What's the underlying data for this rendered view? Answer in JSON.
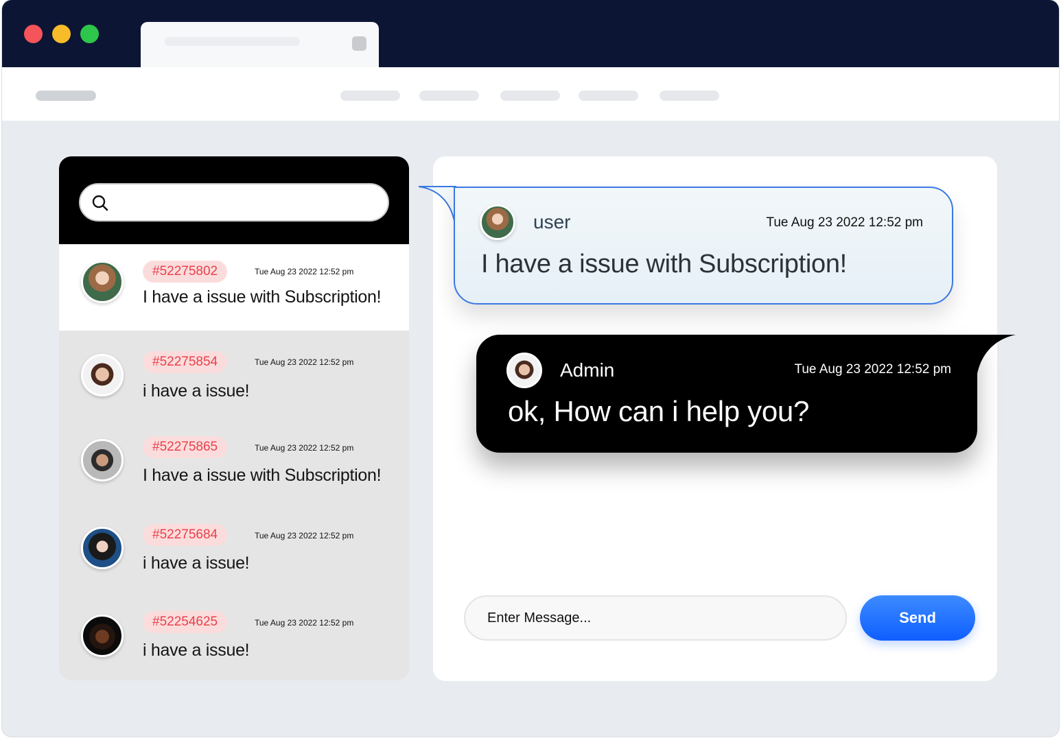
{
  "browser": {
    "traffic_lights": [
      "close",
      "minimize",
      "maximize"
    ]
  },
  "search": {
    "placeholder": ""
  },
  "tickets": [
    {
      "id": "#52275802",
      "time": "Tue Aug 23 2022 12:52 pm",
      "message": "I have a issue with Subscription!",
      "active": true
    },
    {
      "id": "#52275854",
      "time": "Tue Aug 23 2022 12:52 pm",
      "message": "i have a issue!",
      "active": false
    },
    {
      "id": "#52275865",
      "time": "Tue Aug 23 2022 12:52 pm",
      "message": "I have a issue with Subscription!",
      "active": false
    },
    {
      "id": "#52275684",
      "time": "Tue Aug 23 2022 12:52 pm",
      "message": "i have a issue!",
      "active": false
    },
    {
      "id": "#52254625",
      "time": "Tue Aug 23 2022 12:52 pm",
      "message": "i have a issue!",
      "active": false
    }
  ],
  "chat": {
    "messages": [
      {
        "sender": "user",
        "time": "Tue Aug 23 2022 12:52 pm",
        "text": "I have a issue with Subscription!"
      },
      {
        "sender": "Admin",
        "time": "Tue Aug 23 2022 12:52 pm",
        "text": "ok, How can i help you?"
      }
    ],
    "input_placeholder": "Enter Message...",
    "send_label": "Send"
  },
  "colors": {
    "titlebar": "#0c1634",
    "badge_text": "#e8414b",
    "badge_bg": "#fbdcdc",
    "send_button": "#1a6bff",
    "user_bubble_border": "#3a78e3"
  }
}
